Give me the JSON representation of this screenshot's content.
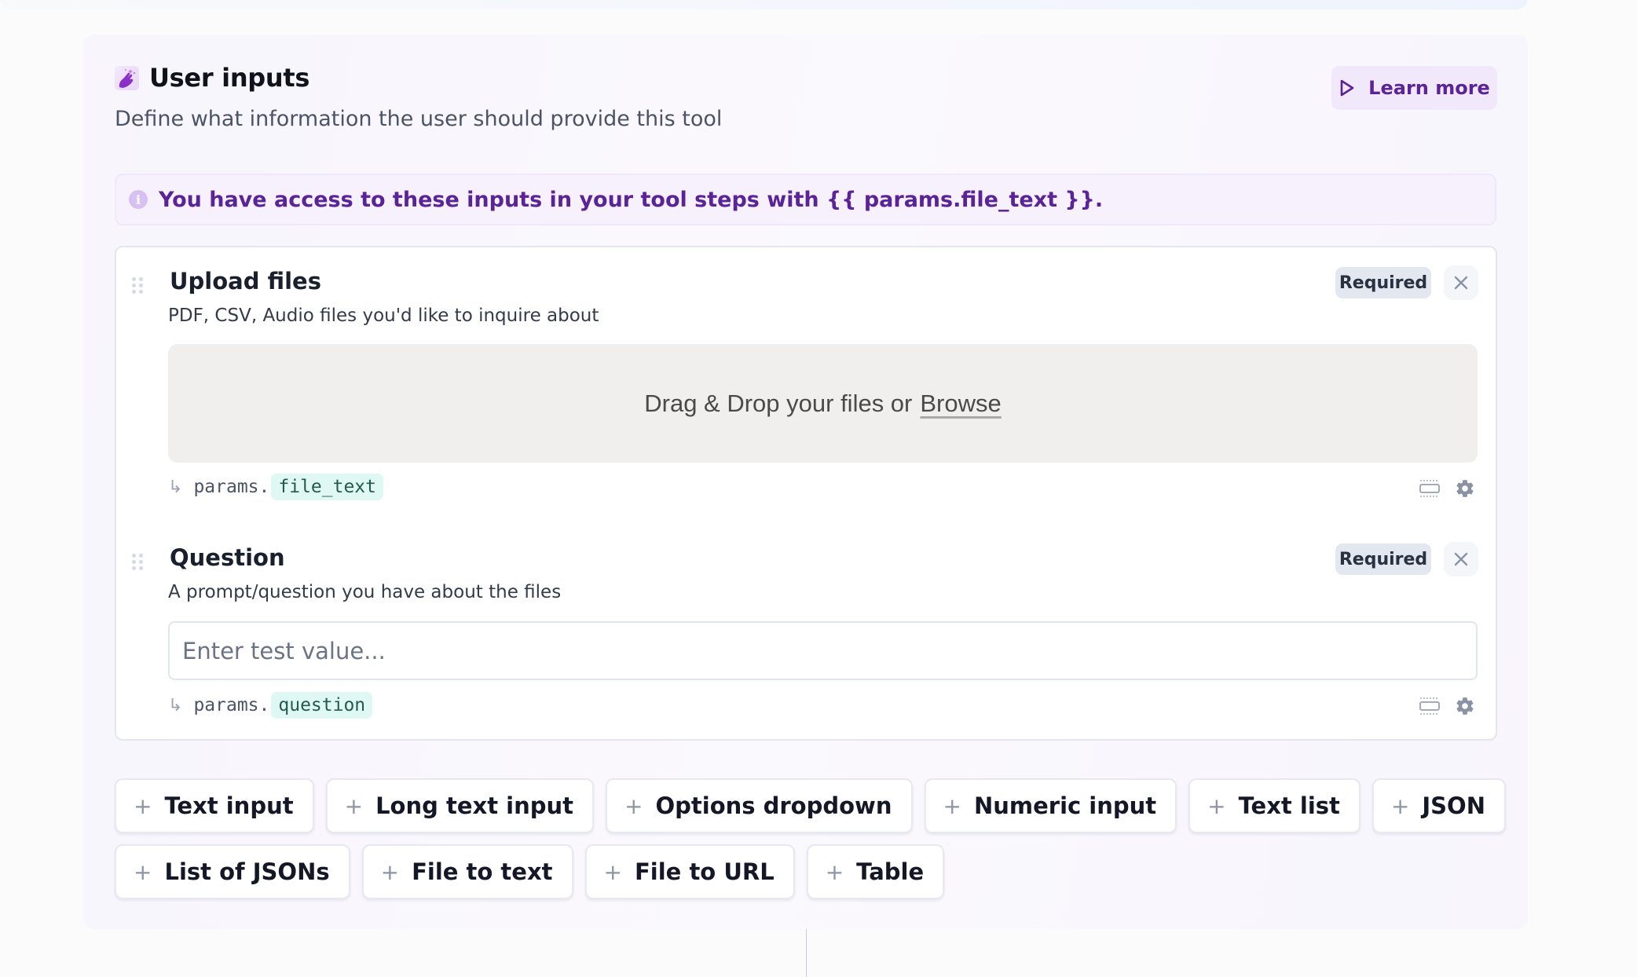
{
  "header": {
    "title": "User inputs",
    "subtitle": "Define what information the user should provide this tool",
    "icon": "magic-hand-icon",
    "learn_more_label": "Learn more"
  },
  "info_banner": {
    "icon": "info-icon",
    "text": "You have access to these inputs in your tool steps with {{ params.file_text }}."
  },
  "fields": [
    {
      "title": "Upload files",
      "description": "PDF, CSV, Audio files you'd like to inquire about",
      "required_label": "Required",
      "dropzone_text": "Drag & Drop your files or",
      "dropzone_link": "Browse",
      "params_prefix": "params.",
      "params_key": "file_text",
      "params_arrow": "↳"
    },
    {
      "title": "Question",
      "description": "A prompt/question you have about the files",
      "required_label": "Required",
      "input_placeholder": "Enter test value...",
      "input_value": "",
      "params_prefix": "params.",
      "params_key": "question",
      "params_arrow": "↳"
    }
  ],
  "add_buttons": {
    "plus": "+",
    "row1": [
      "Text input",
      "Long text input",
      "Options dropdown",
      "Numeric input",
      "Text list",
      "JSON"
    ],
    "row2": [
      "List of JSONs",
      "File to text",
      "File to URL",
      "Table"
    ]
  },
  "colors": {
    "accent": "#5b2398",
    "accent_bg": "#f1e8fc",
    "params_key_bg": "#e0f8f3",
    "badge_bg": "#e3e7ef"
  }
}
